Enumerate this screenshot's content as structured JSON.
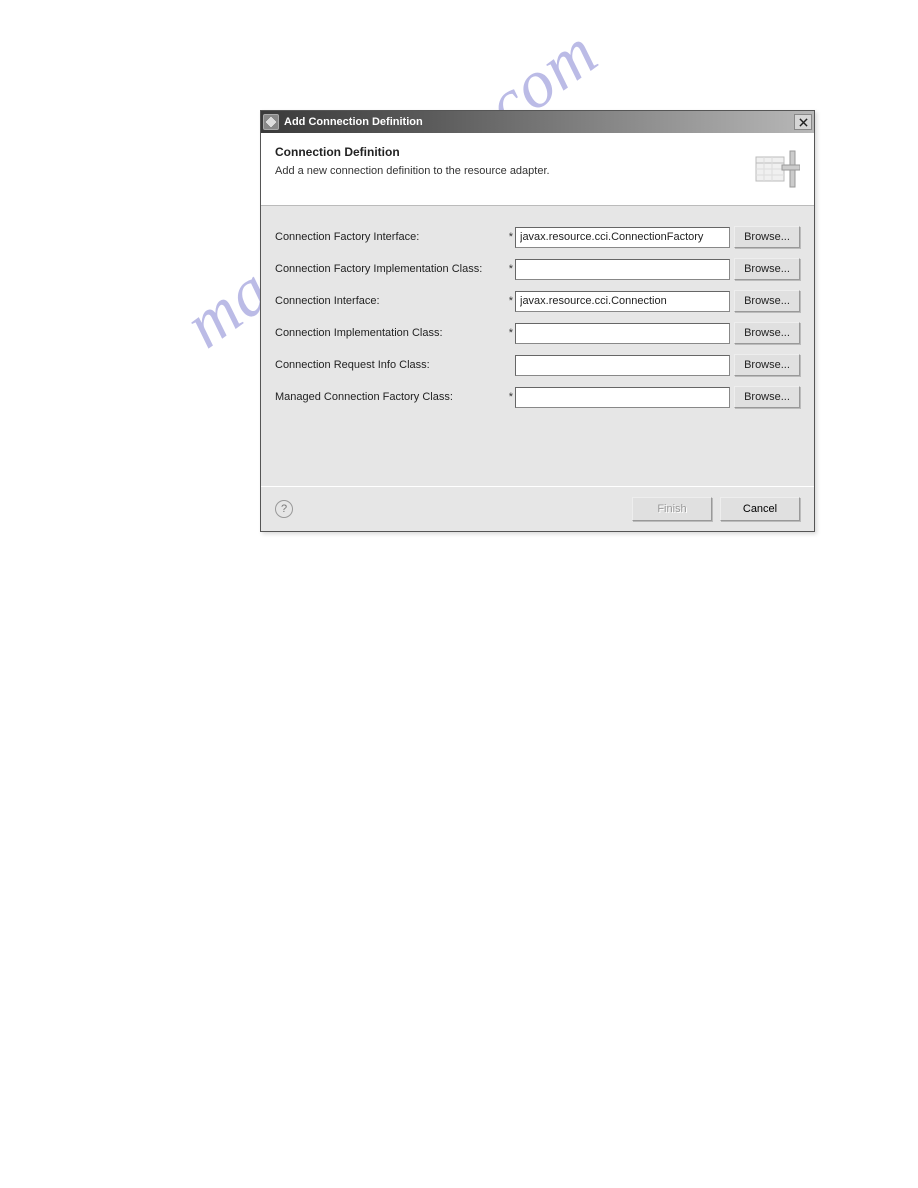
{
  "window": {
    "title": "Add Connection Definition"
  },
  "header": {
    "title": "Connection Definition",
    "description": "Add a new connection definition to the resource adapter."
  },
  "form": {
    "rows": [
      {
        "label": "Connection Factory Interface:",
        "required": "*",
        "value": "javax.resource.cci.ConnectionFactory",
        "browse": "Browse..."
      },
      {
        "label": "Connection Factory Implementation Class:",
        "required": "*",
        "value": "",
        "browse": "Browse..."
      },
      {
        "label": "Connection Interface:",
        "required": "*",
        "value": "javax.resource.cci.Connection",
        "browse": "Browse..."
      },
      {
        "label": "Connection Implementation Class:",
        "required": "*",
        "value": "",
        "browse": "Browse..."
      },
      {
        "label": "Connection Request Info Class:",
        "required": "",
        "value": "",
        "browse": "Browse..."
      },
      {
        "label": "Managed Connection Factory Class:",
        "required": "*",
        "value": "",
        "browse": "Browse..."
      }
    ]
  },
  "footer": {
    "help": "?",
    "finish": "Finish",
    "cancel": "Cancel"
  },
  "watermark": "manualshive.com"
}
